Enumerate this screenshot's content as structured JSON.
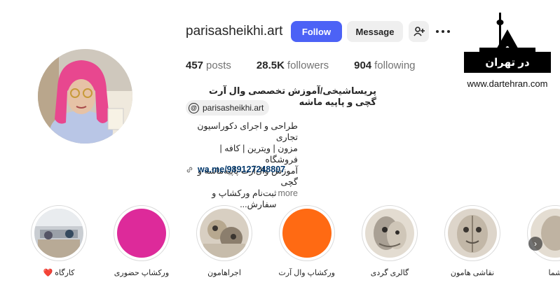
{
  "profile": {
    "username": "parisasheikhi.art",
    "follow_label": "Follow",
    "message_label": "Message",
    "add_user_icon": "add-user-icon",
    "more_icon": "more-options-icon",
    "stats": {
      "posts_count": "457",
      "posts_label": "posts",
      "followers_count": "28.5K",
      "followers_label": "followers",
      "following_count": "904",
      "following_label": "following"
    },
    "bio": {
      "title": "پریساشیخی/آموزش تخصصی وال آرت گچی و پاپیه ماشه",
      "threads_handle": "parisasheikhi.art",
      "threads_icon_glyph": "@",
      "lines": [
        "طراحی و اجرای دکوراسیون تجاری",
        "مزون | ویترین | کافه | فروشگاه",
        "آموزش وال‌آرت پاپیه‌ماشه و گچی",
        "ثبت‌نام ورکشاپ و سفارش..."
      ],
      "more_label": "more",
      "link": "wa.me/989127248807"
    }
  },
  "logo": {
    "bar_text": "در تهران",
    "site": "www.dartehran.com"
  },
  "highlights": [
    {
      "caption": "کارگاه ❤️",
      "style": "workshop-photo"
    },
    {
      "caption": "ورکشاپ حضوری",
      "style": "solid",
      "color": "#dd2a9a"
    },
    {
      "caption": "اجراهامون",
      "style": "sculpture"
    },
    {
      "caption": "ورکشاپ وال آرت",
      "style": "solid",
      "color": "#ff6a13"
    },
    {
      "caption": "گالری گردی",
      "style": "sculpture"
    },
    {
      "caption": "نقاشی هامون",
      "style": "sculpture"
    },
    {
      "caption": "شما",
      "style": "sculpture"
    }
  ],
  "next_icon": "chevron-right-icon",
  "colors": {
    "accent": "#4c62f6",
    "link": "#00376b",
    "muted": "#737373"
  }
}
